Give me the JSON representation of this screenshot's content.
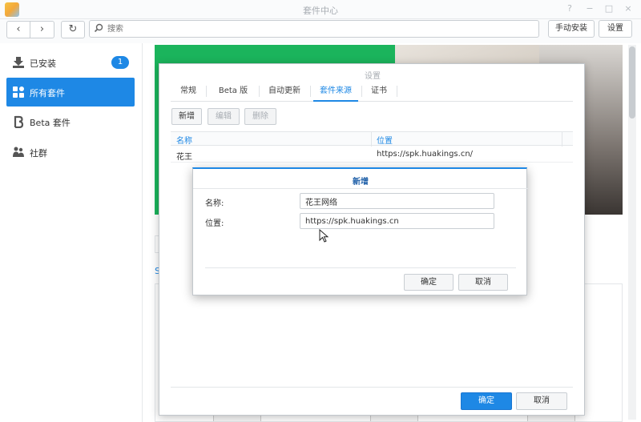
{
  "window": {
    "title": "套件中心",
    "controls": [
      "?",
      "−",
      "□",
      "×"
    ]
  },
  "toolbar": {
    "back_label": "‹",
    "forward_label": "›",
    "refresh_label": "↻",
    "search_placeholder": "搜索",
    "manual_install_label": "手动安装",
    "settings_label": "设置"
  },
  "sidebar": {
    "items": [
      {
        "label": "已安装",
        "icon": "download-icon",
        "badge": "1"
      },
      {
        "label": "所有套件",
        "icon": "grid-icon"
      },
      {
        "label": "Beta 套件",
        "icon": "beta-icon"
      },
      {
        "label": "社群",
        "icon": "community-icon"
      }
    ]
  },
  "main": {
    "partial_letter": "S"
  },
  "settings_dialog": {
    "title": "设置",
    "tabs": [
      "常规",
      "Beta 版",
      "自动更新",
      "套件来源",
      "证书"
    ],
    "active_tab": "套件来源",
    "toolbar": {
      "add": "新增",
      "edit": "编辑",
      "delete": "删除"
    },
    "table": {
      "headers": [
        "名称",
        "位置"
      ],
      "rows": [
        {
          "name": "花王",
          "location": "https://spk.huakings.cn/"
        }
      ]
    },
    "ok_label": "确定",
    "cancel_label": "取消"
  },
  "add_dialog": {
    "title": "新增",
    "name_label": "名称:",
    "name_value": "花王网络",
    "location_label": "位置:",
    "location_value": "https://spk.huakings.cn",
    "ok_label": "确定",
    "cancel_label": "取消"
  },
  "colors": {
    "accent": "#1e88e5",
    "banner": "#1bb45c"
  }
}
